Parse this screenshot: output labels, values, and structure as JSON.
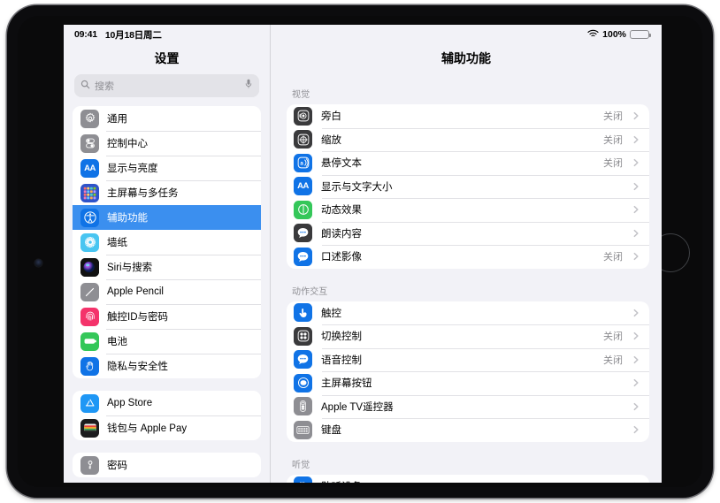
{
  "status_bar": {
    "time": "09:41",
    "date": "10月18日周二",
    "wifi_icon": "wifi-icon",
    "battery_percent": "100%",
    "battery_icon": "battery-full-icon"
  },
  "sidebar": {
    "title": "设置",
    "search": {
      "placeholder": "搜索",
      "search_icon": "search-icon",
      "mic_icon": "microphone-icon"
    },
    "groups": [
      {
        "items": [
          {
            "label": "通用",
            "icon": "gear-icon",
            "color": "#8e8e93"
          },
          {
            "label": "控制中心",
            "icon": "sliders-icon",
            "color": "#8e8e93"
          },
          {
            "label": "显示与亮度",
            "icon": "text-size-icon",
            "color": "#1073e6"
          },
          {
            "label": "主屏幕与多任务",
            "icon": "home-grid-icon",
            "color": "#2f54c9"
          },
          {
            "label": "辅助功能",
            "icon": "accessibility-icon",
            "color": "#1073e6",
            "selected": true
          },
          {
            "label": "墙纸",
            "icon": "wallpaper-icon",
            "color": "#49c5f1"
          },
          {
            "label": "Siri与搜索",
            "icon": "siri-icon",
            "color": "#1c1c1e"
          },
          {
            "label": "Apple Pencil",
            "icon": "pencil-icon",
            "color": "#8e8e93"
          },
          {
            "label": "触控ID与密码",
            "icon": "fingerprint-icon",
            "color": "#f4336b"
          },
          {
            "label": "电池",
            "icon": "battery-icon",
            "color": "#34c759"
          },
          {
            "label": "隐私与安全性",
            "icon": "hand-raised-icon",
            "color": "#1073e6"
          }
        ]
      },
      {
        "items": [
          {
            "label": "App Store",
            "icon": "appstore-icon",
            "color": "#1f97f5"
          },
          {
            "label": "钱包与 Apple Pay",
            "icon": "wallet-icon",
            "color": "#1c1c1e"
          }
        ]
      },
      {
        "items": [
          {
            "label": "密码",
            "icon": "key-icon",
            "color": "#8e8e93"
          }
        ]
      }
    ]
  },
  "detail": {
    "title": "辅助功能",
    "sections": [
      {
        "header": "视觉",
        "rows": [
          {
            "label": "旁白",
            "value": "关闭",
            "icon": "voiceover-icon",
            "color": "#3a3a3c"
          },
          {
            "label": "缩放",
            "value": "关闭",
            "icon": "zoom-icon",
            "color": "#3a3a3c"
          },
          {
            "label": "悬停文本",
            "value": "关闭",
            "icon": "hover-text-icon",
            "color": "#1073e6"
          },
          {
            "label": "显示与文字大小",
            "value": "",
            "icon": "display-text-size-icon",
            "color": "#1073e6"
          },
          {
            "label": "动态效果",
            "value": "",
            "icon": "motion-icon",
            "color": "#34c759"
          },
          {
            "label": "朗读内容",
            "value": "",
            "icon": "spoken-content-icon",
            "color": "#3a3a3c"
          },
          {
            "label": "口述影像",
            "value": "关闭",
            "icon": "audio-descriptions-icon",
            "color": "#1073e6"
          }
        ]
      },
      {
        "header": "动作交互",
        "rows": [
          {
            "label": "触控",
            "value": "",
            "icon": "touch-icon",
            "color": "#1073e6"
          },
          {
            "label": "切换控制",
            "value": "关闭",
            "icon": "switch-control-icon",
            "color": "#3a3a3c"
          },
          {
            "label": "语音控制",
            "value": "关闭",
            "icon": "voice-control-icon",
            "color": "#1073e6"
          },
          {
            "label": "主屏幕按钮",
            "value": "",
            "icon": "home-button-icon",
            "color": "#1073e6"
          },
          {
            "label": "Apple TV遥控器",
            "value": "",
            "icon": "apple-tv-remote-icon",
            "color": "#8e8e93"
          },
          {
            "label": "键盘",
            "value": "",
            "icon": "keyboard-icon",
            "color": "#8e8e93"
          }
        ]
      },
      {
        "header": "听觉",
        "rows": [
          {
            "label": "助听设备",
            "value": "",
            "icon": "hearing-devices-icon",
            "color": "#1073e6"
          }
        ]
      }
    ]
  }
}
